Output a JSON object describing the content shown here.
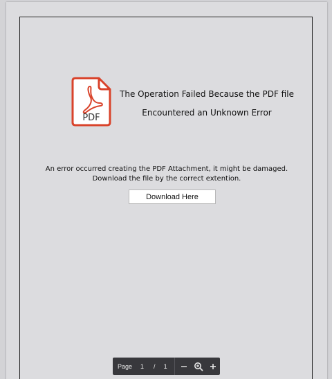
{
  "document": {
    "icon": "pdf-file-icon",
    "icon_label": "PDF",
    "heading_line1": "The Operation Failed Because the PDF file",
    "heading_line2": "Encountered an Unknown Error",
    "message_line1": "An error occurred creating the PDF Attachment, it might be damaged.",
    "message_line2": "Download the file by the correct extention.",
    "download_button_label": "Download Here"
  },
  "toolbar": {
    "page_label": "Page",
    "current_page": "1",
    "separator": "/",
    "total_pages": "1",
    "zoom_out_icon": "minus-icon",
    "zoom_icon": "magnifier-plus-icon",
    "zoom_in_icon": "plus-icon"
  },
  "colors": {
    "pdf_red": "#d9432b",
    "toolbar_bg": "#38383c",
    "page_bg": "#dcdcdf"
  }
}
